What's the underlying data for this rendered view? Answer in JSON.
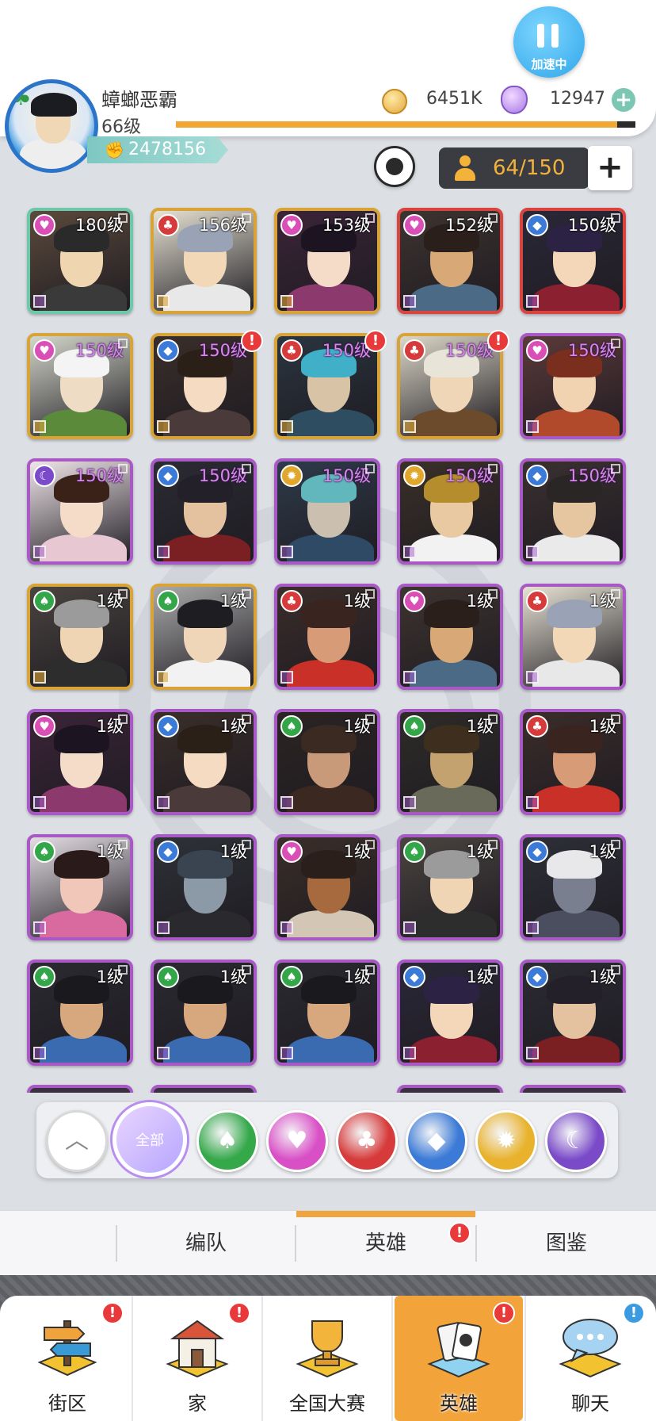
{
  "header": {
    "speed_label": "加速中",
    "player_name": "蟑螂恶霸",
    "player_level": "66级",
    "power": "2478156",
    "coins": "6451K",
    "gems": "12947",
    "exp_progress": 0.96,
    "hero_count": "64/150"
  },
  "heroes": [
    {
      "level": "180级",
      "faction": "heart",
      "frame": "rainbow",
      "alert": false,
      "skin": "#f0d6b0",
      "hair": "#2a2a2a",
      "body": "#3a3a3a",
      "bg": "#5b4a3c"
    },
    {
      "level": "156级",
      "faction": "club",
      "frame": "gold",
      "alert": false,
      "skin": "#f2d8b6",
      "hair": "#9aa3b5",
      "body": "#e8e8e8",
      "bg": "#e7e2d3"
    },
    {
      "level": "153级",
      "faction": "heart",
      "frame": "gold",
      "alert": false,
      "skin": "#f5dcc8",
      "hair": "#1c1420",
      "body": "#8c3a6e",
      "bg": "#3b2438"
    },
    {
      "level": "152级",
      "faction": "heart",
      "frame": "red",
      "alert": false,
      "skin": "#d9a877",
      "hair": "#2a1f1a",
      "body": "#4b6a86",
      "bg": "#3e3430"
    },
    {
      "level": "150级",
      "faction": "diamond",
      "frame": "red",
      "alert": false,
      "skin": "#f3d7b8",
      "hair": "#2c2244",
      "body": "#8a2030",
      "bg": "#2a2838"
    },
    {
      "level": "150级",
      "faction": "heart",
      "frame": "gold",
      "alert": false,
      "skin": "#efdcc4",
      "hair": "#f4f4f4",
      "body": "#5a8a3a",
      "bg": "#d4d7cb"
    },
    {
      "level": "150级",
      "faction": "diamond",
      "frame": "gold",
      "alert": true,
      "skin": "#f4dbc2",
      "hair": "#2b2018",
      "body": "#4a3a3a",
      "bg": "#3a2e2a"
    },
    {
      "level": "150级",
      "faction": "club",
      "frame": "gold",
      "alert": true,
      "skin": "#d9c3a6",
      "hair": "#3fb0c8",
      "body": "#2e4d60",
      "bg": "#2a3540"
    },
    {
      "level": "150级",
      "faction": "club",
      "frame": "gold",
      "alert": true,
      "skin": "#efd6b7",
      "hair": "#e8e4d8",
      "body": "#6b4b2c",
      "bg": "#dcd7c8"
    },
    {
      "level": "150级",
      "faction": "heart",
      "frame": "purple",
      "alert": false,
      "skin": "#f1d3b2",
      "hair": "#7a2e1e",
      "body": "#b04a2a",
      "bg": "#5c3a3a"
    },
    {
      "level": "150级",
      "faction": "moon",
      "frame": "purple",
      "alert": false,
      "skin": "#f4dcc8",
      "hair": "#3b2218",
      "body": "#e7c7d2",
      "bg": "#f0e6ea"
    },
    {
      "level": "150级",
      "faction": "diamond",
      "frame": "purple",
      "alert": false,
      "skin": "#e4c2a0",
      "hair": "#23202a",
      "body": "#7a1f22",
      "bg": "#2b2b33"
    },
    {
      "level": "150级",
      "faction": "sun",
      "frame": "purple",
      "alert": false,
      "skin": "#cbbfb0",
      "hair": "#62b7bd",
      "body": "#2e4a64",
      "bg": "#2e3b4a"
    },
    {
      "level": "150级",
      "faction": "sun",
      "frame": "purple",
      "alert": false,
      "skin": "#e9c9a2",
      "hair": "#b58d2c",
      "body": "#f2f2f2",
      "bg": "#3a3028"
    },
    {
      "level": "150级",
      "faction": "diamond",
      "frame": "purple",
      "alert": false,
      "skin": "#e6c6a0",
      "hair": "#2b2626",
      "body": "#eaeaea",
      "bg": "#3a3030"
    },
    {
      "level": "1级",
      "faction": "spade",
      "frame": "gold",
      "alert": false,
      "skin": "#efd5b4",
      "hair": "#9b9b9b",
      "body": "#2d2d2d",
      "bg": "#4a4440"
    },
    {
      "level": "1级",
      "faction": "spade",
      "frame": "gold",
      "alert": false,
      "skin": "#f0d6b8",
      "hair": "#1e1e22",
      "body": "#f2f2f2",
      "bg": "#a9a9a9"
    },
    {
      "level": "1级",
      "faction": "club",
      "frame": "purple",
      "alert": false,
      "skin": "#d79b78",
      "hair": "#3a2420",
      "body": "#c83028",
      "bg": "#3b2d2a"
    },
    {
      "level": "1级",
      "faction": "heart",
      "frame": "purple",
      "alert": false,
      "skin": "#d9a877",
      "hair": "#2a1f1a",
      "body": "#4b6a86",
      "bg": "#3e3430"
    },
    {
      "level": "1级",
      "faction": "club",
      "frame": "purple",
      "alert": false,
      "skin": "#f2d8b6",
      "hair": "#9aa3b5",
      "body": "#e8e8e8",
      "bg": "#e7e2d3"
    },
    {
      "level": "1级",
      "faction": "heart",
      "frame": "purple",
      "alert": false,
      "skin": "#f5dcc8",
      "hair": "#1c1420",
      "body": "#8c3a6e",
      "bg": "#3b2438"
    },
    {
      "level": "1级",
      "faction": "diamond",
      "frame": "purple",
      "alert": false,
      "skin": "#f4dbc2",
      "hair": "#2b2018",
      "body": "#4a3a3a",
      "bg": "#3a2e2a"
    },
    {
      "level": "1级",
      "faction": "spade",
      "frame": "purple",
      "alert": false,
      "skin": "#c99a7a",
      "hair": "#3a2a22",
      "body": "#3b2820",
      "bg": "#2b2422"
    },
    {
      "level": "1级",
      "faction": "spade",
      "frame": "purple",
      "alert": false,
      "skin": "#c4a270",
      "hair": "#3e2e1e",
      "body": "#6a6a5a",
      "bg": "#2e2c28"
    },
    {
      "level": "1级",
      "faction": "club",
      "frame": "purple",
      "alert": false,
      "skin": "#d79b78",
      "hair": "#3a2420",
      "body": "#c83028",
      "bg": "#3b2d2a"
    },
    {
      "level": "1级",
      "faction": "spade",
      "frame": "purple",
      "alert": false,
      "skin": "#f0c7b8",
      "hair": "#2a1a1a",
      "body": "#d86aa0",
      "bg": "#e4dde4"
    },
    {
      "level": "1级",
      "faction": "diamond",
      "frame": "purple",
      "alert": false,
      "skin": "#8b9aa6",
      "hair": "#3a4450",
      "body": "#2a2a2e",
      "bg": "#2e3238"
    },
    {
      "level": "1级",
      "faction": "heart",
      "frame": "purple",
      "alert": false,
      "skin": "#a7693e",
      "hair": "#2a1f1a",
      "body": "#d4c6b4",
      "bg": "#3a2e28"
    },
    {
      "level": "1级",
      "faction": "spade",
      "frame": "purple",
      "alert": false,
      "skin": "#efd5b4",
      "hair": "#9b9b9b",
      "body": "#2d2d2d",
      "bg": "#4a4440"
    },
    {
      "level": "1级",
      "faction": "diamond",
      "frame": "purple",
      "alert": false,
      "skin": "#7a7f90",
      "hair": "#e8e8ea",
      "body": "#4a4e5e",
      "bg": "#2d2f38"
    },
    {
      "level": "1级",
      "faction": "spade",
      "frame": "purple",
      "alert": false,
      "skin": "#d7a87e",
      "hair": "#1a1a1e",
      "body": "#3a6ab0",
      "bg": "#2a2a30"
    },
    {
      "level": "1级",
      "faction": "spade",
      "frame": "purple",
      "alert": false,
      "skin": "#d7a87e",
      "hair": "#1a1a1e",
      "body": "#3a6ab0",
      "bg": "#2a2a30"
    },
    {
      "level": "1级",
      "faction": "spade",
      "frame": "purple",
      "alert": false,
      "skin": "#d7a87e",
      "hair": "#1a1a1e",
      "body": "#3a6ab0",
      "bg": "#2a2a30"
    },
    {
      "level": "1级",
      "faction": "diamond",
      "frame": "purple",
      "alert": false,
      "skin": "#f3d7b8",
      "hair": "#2c2244",
      "body": "#8a2030",
      "bg": "#2a2838"
    },
    {
      "level": "1级",
      "faction": "diamond",
      "frame": "purple",
      "alert": false,
      "skin": "#e4c2a0",
      "hair": "#23202a",
      "body": "#7a1f22",
      "bg": "#2b2b33"
    }
  ],
  "faction_colors": {
    "heart": "#d94fb6",
    "club": "#d63a3a",
    "diamond": "#3b7ad6",
    "spade": "#34a64a",
    "sun": "#e0a72c",
    "moon": "#7a4ac8"
  },
  "faction_glyphs": {
    "heart": "♥",
    "club": "♣",
    "diamond": "◆",
    "spade": "♠",
    "sun": "✹",
    "moon": "☾"
  },
  "filters": {
    "all_label": "全部",
    "items": [
      {
        "name": "spade",
        "color": "#35a84a",
        "glyph": "♠"
      },
      {
        "name": "heart",
        "color": "#d94fc6",
        "glyph": "♥"
      },
      {
        "name": "club",
        "color": "#d63a3a",
        "glyph": "♣"
      },
      {
        "name": "diamond",
        "color": "#3b7ad6",
        "glyph": "◆"
      },
      {
        "name": "sun",
        "color": "#e8b22c",
        "glyph": "✹"
      },
      {
        "name": "moon",
        "color": "#7a4ac8",
        "glyph": "☾"
      }
    ]
  },
  "subtabs": {
    "formation": "编队",
    "heroes": "英雄",
    "codex": "图鉴"
  },
  "nav": {
    "district": "街区",
    "home": "家",
    "national": "全国大赛",
    "heroes": "英雄",
    "chat": "聊天"
  }
}
